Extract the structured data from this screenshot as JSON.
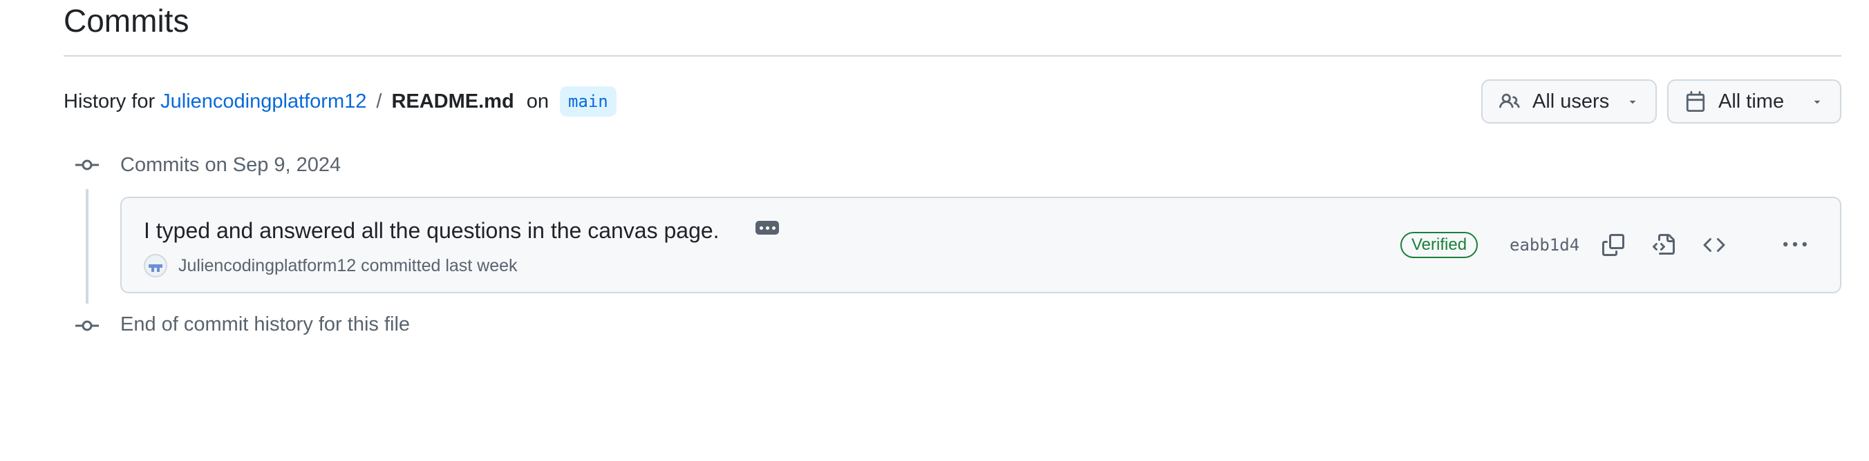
{
  "page": {
    "title": "Commits"
  },
  "history": {
    "prefix": "History for",
    "repo": "Juliencodingplatform12",
    "separator": "/",
    "file": "README.md",
    "on_label": "on",
    "branch": "main"
  },
  "filters": {
    "users_label": "All users",
    "time_label": "All time"
  },
  "timeline": {
    "group_label": "Commits on Sep 9, 2024",
    "end_label": "End of commit history for this file"
  },
  "commit": {
    "message": "I typed and answered all the questions in the canvas page.",
    "author": "Juliencodingplatform12",
    "action": "committed last week",
    "verified_label": "Verified",
    "sha": "eabb1d4"
  },
  "colors": {
    "link": "#0969da",
    "verified": "#1a7f37",
    "muted": "#59636e",
    "border": "#d1d9e0",
    "card_bg": "#f6f8fa",
    "branch_bg": "#ddf4ff"
  },
  "icons": {
    "users": "people-icon",
    "time": "calendar-icon",
    "copy": "copy-icon",
    "browse": "file-code-icon",
    "code": "code-icon",
    "more": "kebab-horizontal-icon",
    "commit": "git-commit-icon"
  }
}
